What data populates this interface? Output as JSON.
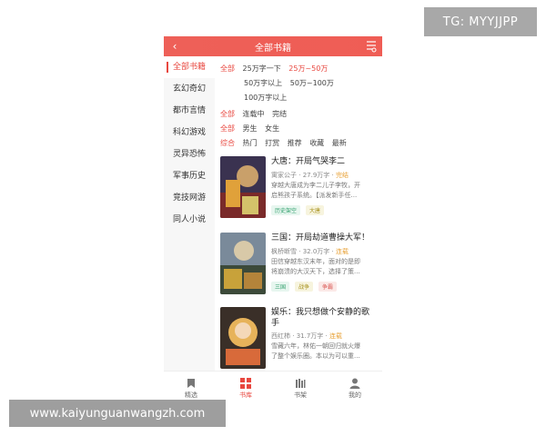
{
  "watermarks": {
    "top_right": "TG: MYYJJPP",
    "bottom_left": "www.kaiyunguanwangzh.com"
  },
  "header": {
    "title": "全部书籍",
    "back_icon": "chevron-left-icon",
    "filter_icon": "filter-icon"
  },
  "sidebar": {
    "items": [
      {
        "label": "全部书籍",
        "active": true
      },
      {
        "label": "玄幻奇幻"
      },
      {
        "label": "都市言情"
      },
      {
        "label": "科幻游戏"
      },
      {
        "label": "灵异恐怖"
      },
      {
        "label": "军事历史"
      },
      {
        "label": "竞技网游"
      },
      {
        "label": "同人小说"
      }
    ]
  },
  "filters": {
    "wordcount": [
      "全部",
      "25万字一下",
      "25万~50万",
      "50万字以上",
      "50万~100万",
      "100万字以上"
    ],
    "status": [
      "全部",
      "连载中",
      "完结"
    ],
    "gender": [
      "全部",
      "男生",
      "女生"
    ],
    "sort": [
      "综合",
      "热门",
      "打赏",
      "推荐",
      "收藏",
      "最新"
    ]
  },
  "books": [
    {
      "title": "大唐：开局气哭李二",
      "author": "寓家公子",
      "words": "27.9万字",
      "status": "完结",
      "desc_line1": "穿越大唐成为李二儿子李牧，开",
      "desc_line2": "启熊孩子系统。【派发新手任...",
      "tags": [
        "历史架空",
        "大唐"
      ]
    },
    {
      "title": "三国：开局劫道曹操大军！",
      "author": "枫桥断雪",
      "words": "32.0万字",
      "status": "连载",
      "desc_line1": "田信穿越东汉末年，面对的是即",
      "desc_line2": "将崩溃的大汉天下，选择了策...",
      "tags": [
        "三国",
        "战争",
        "争霸"
      ]
    },
    {
      "title_line1": "娱乐：我只想做个安静的歌",
      "title_line2": "手",
      "author": "西红柿",
      "words": "31.7万字",
      "status": "连载",
      "desc_line1": "雪藏六年，林佑一朝回归就火爆",
      "desc_line2": "了整个娱乐圈。本以为可以重..."
    }
  ],
  "bottom_nav": [
    {
      "label": "精选",
      "icon": "bookmark-icon"
    },
    {
      "label": "书库",
      "icon": "library-icon",
      "active": true
    },
    {
      "label": "书架",
      "icon": "bookshelf-icon"
    },
    {
      "label": "我的",
      "icon": "person-icon"
    }
  ],
  "colors": {
    "accent": "#e8473f",
    "header": "#ef5d55",
    "status_tag": "#e8a33a"
  }
}
